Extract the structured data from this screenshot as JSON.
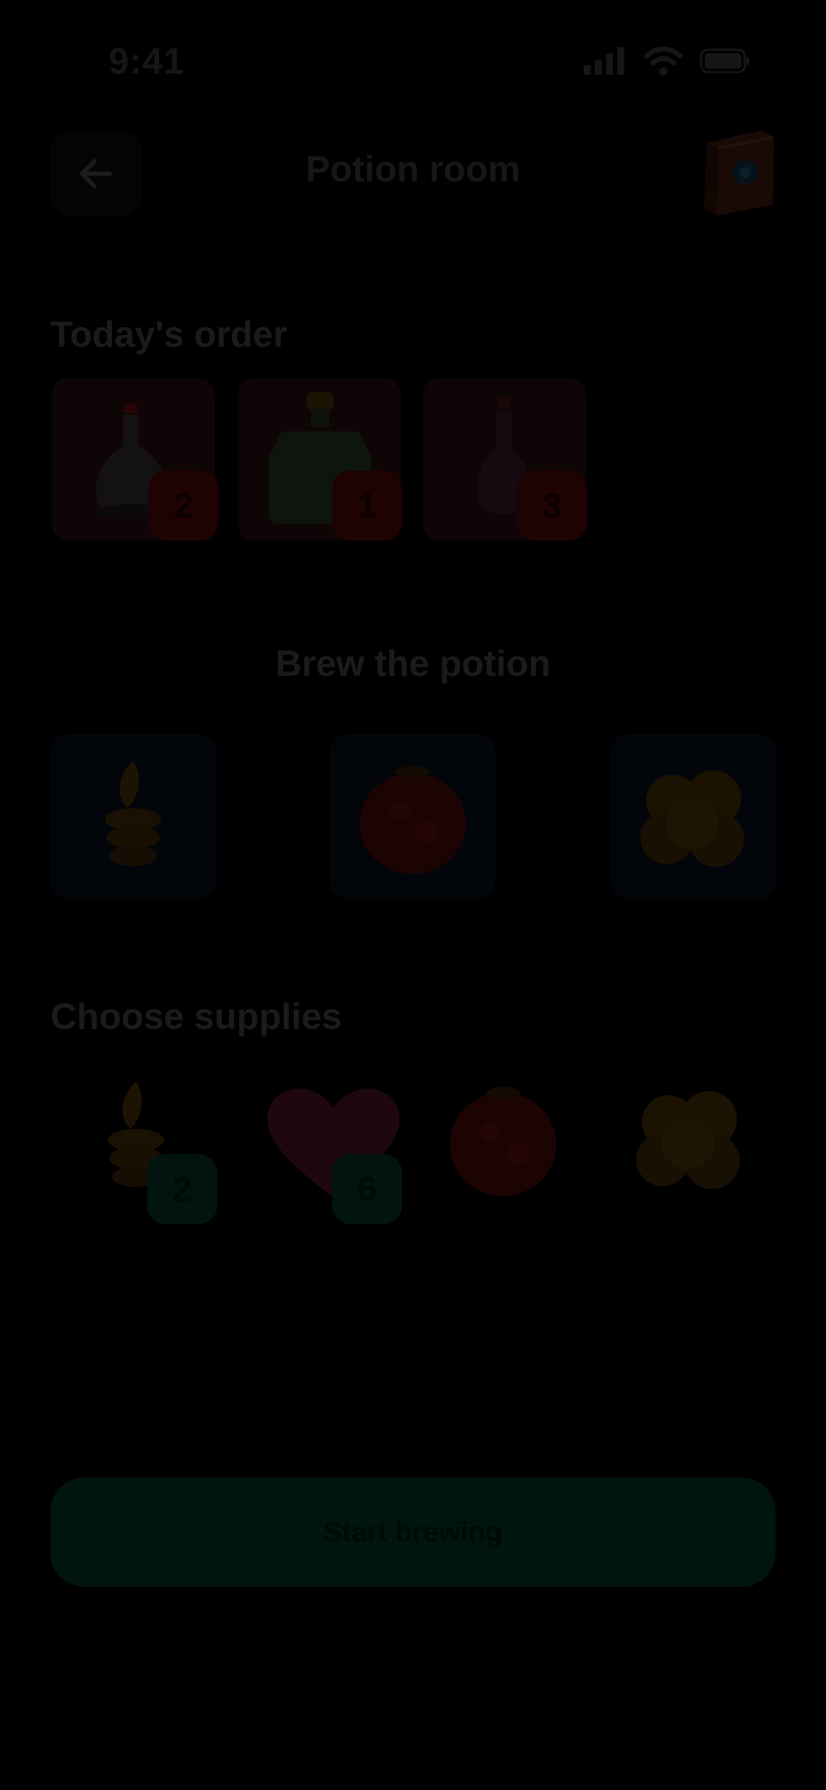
{
  "status_bar": {
    "time": "9:41",
    "icons": [
      "cellular-icon",
      "wifi-icon",
      "battery-icon"
    ]
  },
  "header": {
    "title": "Potion room",
    "back_icon": "arrow-left-icon",
    "book_icon": "spellbook-icon"
  },
  "order": {
    "title": "Today's order",
    "items": [
      {
        "icon": "white-potion-icon",
        "count": "2"
      },
      {
        "icon": "green-potion-icon",
        "count": "1"
      },
      {
        "icon": "pink-potion-icon",
        "count": "3"
      }
    ]
  },
  "brew": {
    "title": "Brew the potion",
    "slots": [
      {
        "icon": "golden-leaves-icon"
      },
      {
        "icon": "red-berry-icon"
      },
      {
        "icon": "yellow-cluster-icon"
      }
    ]
  },
  "supplies": {
    "title": "Choose supplies",
    "items": [
      {
        "icon": "golden-leaves-icon",
        "count": "2"
      },
      {
        "icon": "heart-icon",
        "count": "6"
      },
      {
        "icon": "red-berry-icon",
        "count": ""
      },
      {
        "icon": "yellow-cluster-icon",
        "count": ""
      }
    ]
  },
  "actions": {
    "start_label": "Start brewing"
  },
  "colors": {
    "background": "#000000",
    "accent_red": "#1f0202",
    "accent_teal": "#021410"
  }
}
